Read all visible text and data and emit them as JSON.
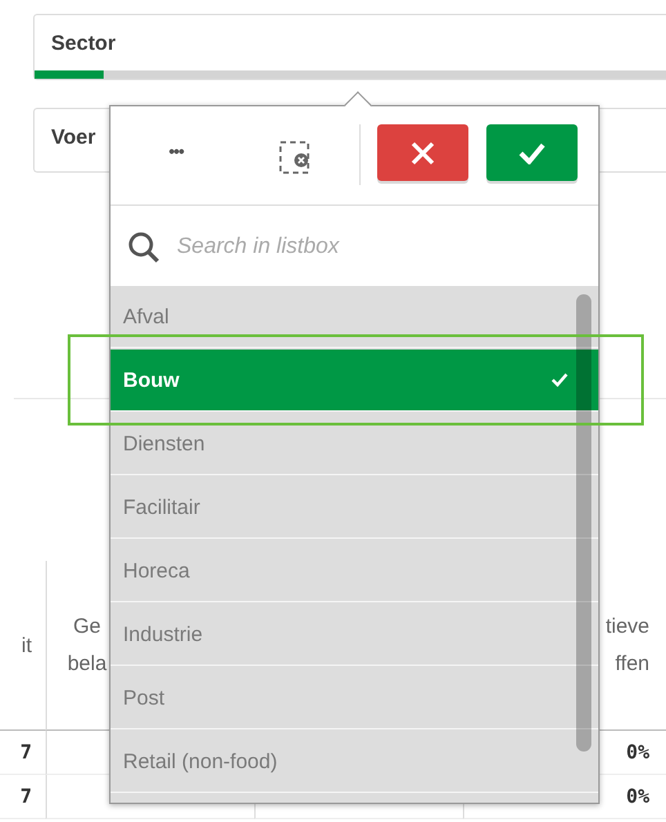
{
  "filters": [
    {
      "title": "Sector",
      "level": 0.11
    },
    {
      "title": "Voer"
    }
  ],
  "table": {
    "columns": [
      {
        "header": "it"
      },
      {
        "header": "Ge bela"
      },
      {},
      {
        "header": "tieve ffen"
      }
    ],
    "rows": [
      [
        "7",
        "",
        "",
        "0%"
      ],
      [
        "7",
        "",
        "",
        "0%"
      ]
    ]
  },
  "listbox": {
    "search": {
      "placeholder": "Search in listbox"
    },
    "more_label": "•••",
    "items": [
      {
        "label": "Afval",
        "selected": false
      },
      {
        "label": "Bouw",
        "selected": true
      },
      {
        "label": "Diensten",
        "selected": false
      },
      {
        "label": "Facilitair",
        "selected": false
      },
      {
        "label": "Horeca",
        "selected": false
      },
      {
        "label": "Industrie",
        "selected": false
      },
      {
        "label": "Post",
        "selected": false
      },
      {
        "label": "Retail (non-food)",
        "selected": false
      }
    ]
  }
}
